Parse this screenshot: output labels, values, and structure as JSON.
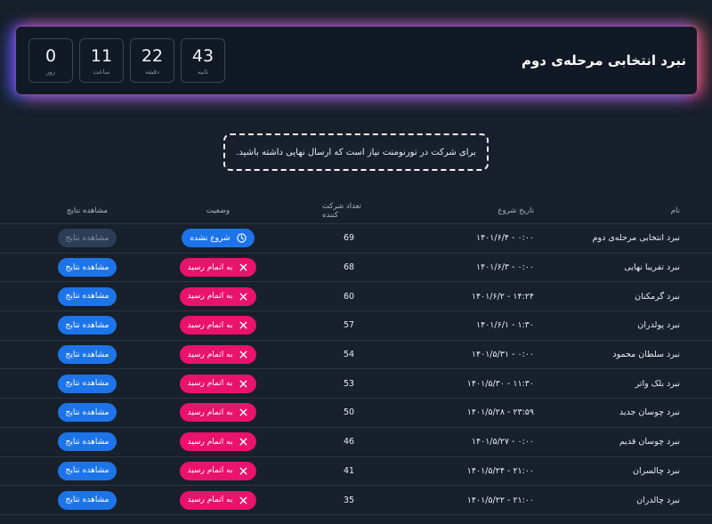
{
  "hero": {
    "title": "نبرد انتخابی مرحله‌ی دوم",
    "countdown": [
      {
        "value": "43",
        "label": "ثانیه"
      },
      {
        "value": "22",
        "label": "دقیقه"
      },
      {
        "value": "11",
        "label": "ساعت"
      },
      {
        "value": "0",
        "label": "روز"
      }
    ]
  },
  "notice": "برای شرکت در تورنومنت نیاز است که ارسال نهایی داشته باشید.",
  "table": {
    "headers": {
      "name": "نام",
      "start_date": "تاریخ شروع",
      "participants": "تعداد شرکت کننده",
      "status": "وضعیت",
      "results": "مشاهده نتایج"
    },
    "rows": [
      {
        "name": "نبرد انتخابی مرحله‌ی دوم",
        "date": "۱۴۰۱/۶/۴ - ۰:۰۰",
        "count": "69",
        "status": "شروع نشده",
        "status_type": "pending",
        "view": "مشاهده نتایج",
        "view_enabled": false
      },
      {
        "name": "نبرد تفریبا نهایی",
        "date": "۱۴۰۱/۶/۳ - ۰:۰۰",
        "count": "68",
        "status": "به اتمام رسید",
        "status_type": "done",
        "view": "مشاهده نتایج",
        "view_enabled": true
      },
      {
        "name": "نبرد گرمکنان",
        "date": "۱۴۰۱/۶/۲ - ۱۴:۲۴",
        "count": "60",
        "status": "به اتمام رسید",
        "status_type": "done",
        "view": "مشاهده نتایج",
        "view_enabled": true
      },
      {
        "name": "نبرد پولدران",
        "date": "۱۴۰۱/۶/۱ - ۱:۳۰",
        "count": "57",
        "status": "به اتمام رسید",
        "status_type": "done",
        "view": "مشاهده نتایج",
        "view_enabled": true
      },
      {
        "name": "نبرد سلطان محمود",
        "date": "۱۴۰۱/۵/۳۱ - ۰:۰۰",
        "count": "54",
        "status": "به اتمام رسید",
        "status_type": "done",
        "view": "مشاهده نتایج",
        "view_enabled": true
      },
      {
        "name": "نبرد بلک واتر",
        "date": "۱۴۰۱/۵/۳۰ - ۱۱:۳۰",
        "count": "53",
        "status": "به اتمام رسید",
        "status_type": "done",
        "view": "مشاهده نتایج",
        "view_enabled": true
      },
      {
        "name": "نبرد چوسان جدید",
        "date": "۱۴۰۱/۵/۲۸ - ۲۳:۵۹",
        "count": "50",
        "status": "به اتمام رسید",
        "status_type": "done",
        "view": "مشاهده نتایج",
        "view_enabled": true
      },
      {
        "name": "نبرد چوسان قدیم",
        "date": "۱۴۰۱/۵/۲۷ - ۰:۰۰",
        "count": "46",
        "status": "به اتمام رسید",
        "status_type": "done",
        "view": "مشاهده نتایج",
        "view_enabled": true
      },
      {
        "name": "نبرد چالسران",
        "date": "۱۴۰۱/۵/۲۴ - ۲۱:۰۰",
        "count": "41",
        "status": "به اتمام رسید",
        "status_type": "done",
        "view": "مشاهده نتایج",
        "view_enabled": true
      },
      {
        "name": "نبرد چالدران",
        "date": "۱۴۰۱/۵/۲۲ - ۲۱:۰۰",
        "count": "35",
        "status": "به اتمام رسید",
        "status_type": "done",
        "view": "مشاهده نتایج",
        "view_enabled": true
      }
    ]
  },
  "colors": {
    "background": "#17202b",
    "hero_bg": "#111a24",
    "button_blue": "#1d74e8",
    "badge_pink": "#e9126c"
  },
  "icons": {
    "done": "close-x-icon",
    "pending": "clock-icon"
  }
}
